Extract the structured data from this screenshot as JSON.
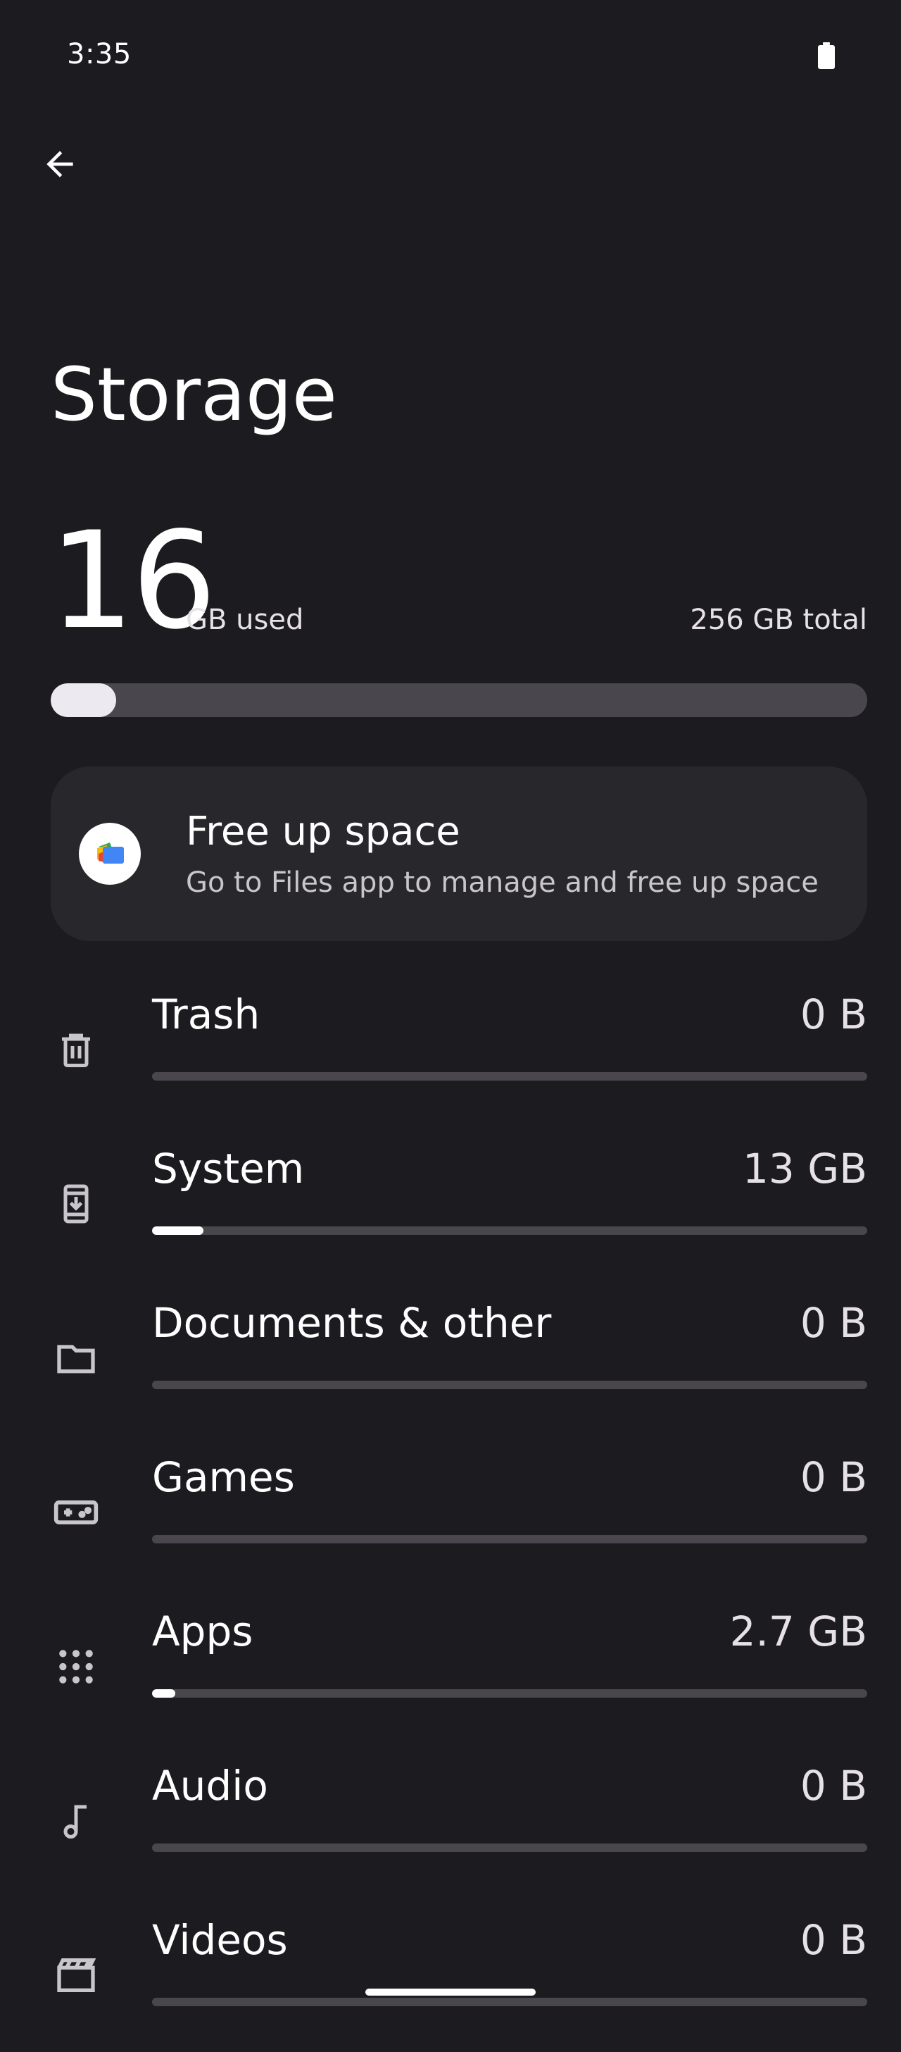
{
  "status_bar": {
    "time": "3:35",
    "battery_icon": "battery-icon"
  },
  "header": {
    "back_icon": "arrow-back-icon",
    "title": "Storage"
  },
  "summary": {
    "used_number": "16",
    "used_label": "GB used",
    "total_label": "256 GB total",
    "used_fraction": 0.08
  },
  "free_up_card": {
    "icon": "files-app-icon",
    "title": "Free up space",
    "subtitle": "Go to Files app to manage and free up space"
  },
  "categories": [
    {
      "icon": "trash-icon",
      "label": "Trash",
      "value": "0 B",
      "fraction": 0
    },
    {
      "icon": "system-update-icon",
      "label": "System",
      "value": "13 GB",
      "fraction": 0.072
    },
    {
      "icon": "folder-icon",
      "label": "Documents & other",
      "value": "0 B",
      "fraction": 0
    },
    {
      "icon": "gamepad-icon",
      "label": "Games",
      "value": "0 B",
      "fraction": 0
    },
    {
      "icon": "apps-grid-icon",
      "label": "Apps",
      "value": "2.7 GB",
      "fraction": 0.032
    },
    {
      "icon": "music-note-icon",
      "label": "Audio",
      "value": "0 B",
      "fraction": 0
    },
    {
      "icon": "movie-icon",
      "label": "Videos",
      "value": "0 B",
      "fraction": 0
    }
  ],
  "colors": {
    "background": "#1c1b1f",
    "card": "#28272c",
    "track": "#49474d",
    "fill": "#ffffff"
  }
}
